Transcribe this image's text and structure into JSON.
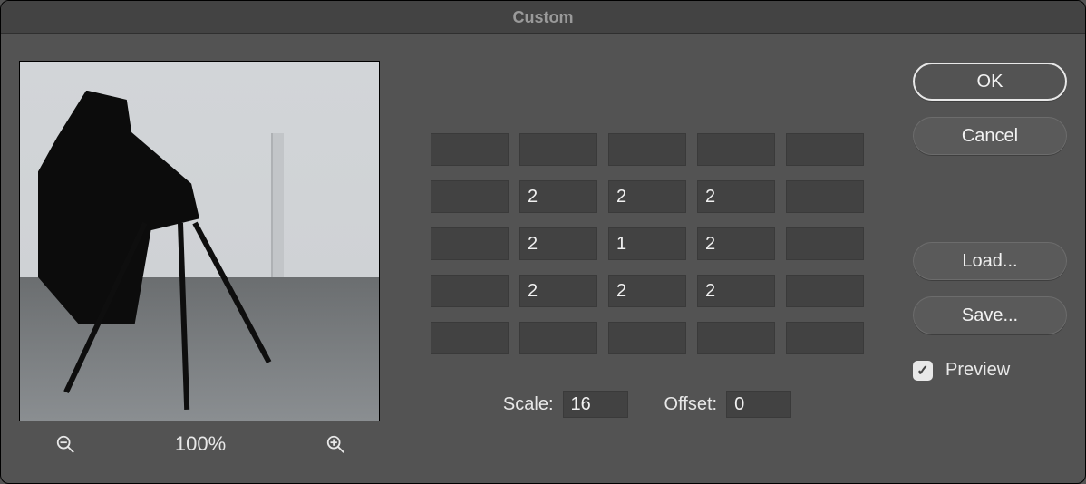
{
  "title": "Custom",
  "preview": {
    "zoom_label": "100%"
  },
  "matrix": {
    "rows": [
      [
        "",
        "",
        "",
        "",
        ""
      ],
      [
        "",
        "2",
        "2",
        "2",
        ""
      ],
      [
        "",
        "2",
        "1",
        "2",
        ""
      ],
      [
        "",
        "2",
        "2",
        "2",
        ""
      ],
      [
        "",
        "",
        "",
        "",
        ""
      ]
    ]
  },
  "scale": {
    "label": "Scale:",
    "value": "16"
  },
  "offset": {
    "label": "Offset:",
    "value": "0"
  },
  "buttons": {
    "ok": "OK",
    "cancel": "Cancel",
    "load": "Load...",
    "save": "Save..."
  },
  "preview_check": {
    "label": "Preview",
    "checked": true
  }
}
